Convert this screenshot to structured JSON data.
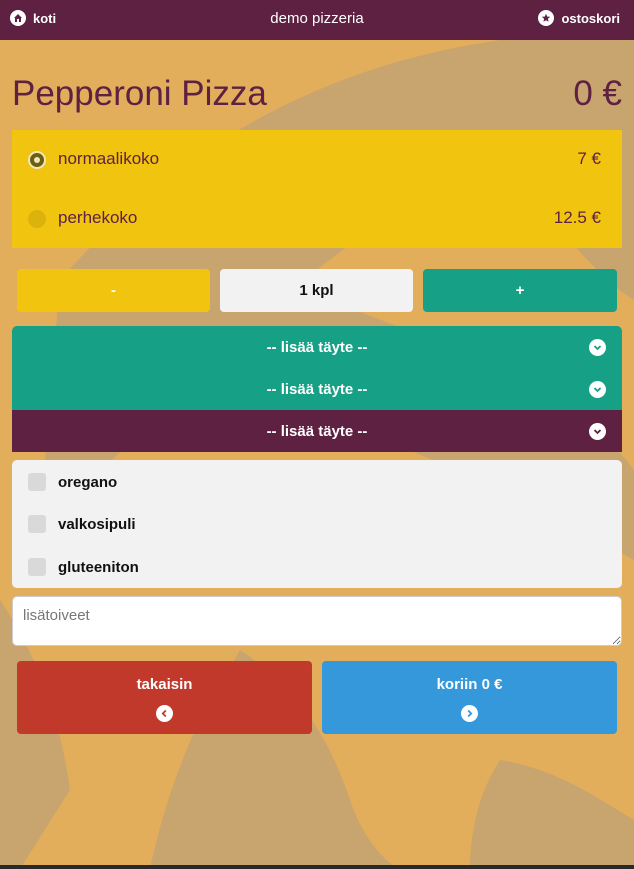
{
  "header": {
    "home_label": "koti",
    "brand": "demo pizzeria",
    "cart_label": "ostoskori"
  },
  "product": {
    "name": "Pepperoni Pizza",
    "total": "0 €"
  },
  "sizes": [
    {
      "label": "normaalikoko",
      "price": "7 €",
      "selected": true
    },
    {
      "label": "perhekoko",
      "price": "12.5 €",
      "selected": false
    }
  ],
  "quantity": {
    "minus": "-",
    "value": "1 kpl",
    "plus": "+"
  },
  "toppings": [
    {
      "label": "-- lisää täyte --"
    },
    {
      "label": "-- lisää täyte --"
    },
    {
      "label": "-- lisää täyte --"
    }
  ],
  "options": [
    {
      "label": "oregano",
      "checked": false
    },
    {
      "label": "valkosipuli",
      "checked": false
    },
    {
      "label": "gluteeniton",
      "checked": false
    }
  ],
  "notes": {
    "placeholder": "lisätoiveet"
  },
  "actions": {
    "back_label": "takaisin",
    "cart_label": "koriin 0 €"
  },
  "colors": {
    "header": "#5e2142",
    "background": "#e3ae5b",
    "yellow": "#f1c40f",
    "teal": "#16a085",
    "red": "#c0392b",
    "blue": "#3498db"
  }
}
